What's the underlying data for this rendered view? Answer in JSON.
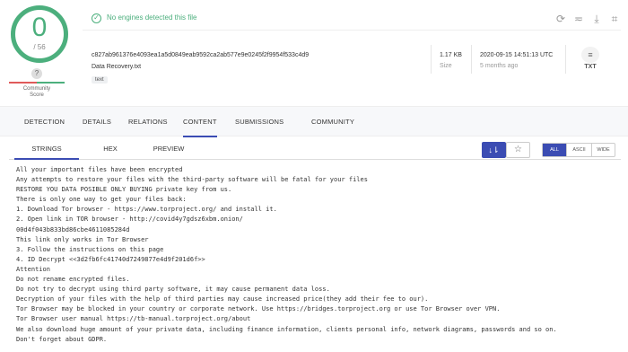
{
  "score": {
    "detections": "0",
    "total": "/ 56"
  },
  "community": {
    "question": "?",
    "bad_mark": "×",
    "good_mark": "✓",
    "label_line1": "Community",
    "label_line2": "Score"
  },
  "banner": {
    "status_text": "No engines detected this file"
  },
  "toolbar_icons": [
    "refresh-icon",
    "similar-icon",
    "download-icon",
    "graph-icon"
  ],
  "file": {
    "hash": "c827ab961376e4093ea1a5d0849eab9592ca2ab577e9e0245f2f9954f533c4d9",
    "name": "Data Recovery.txt",
    "tag": "text",
    "size_value": "1.17 KB",
    "size_label": "Size",
    "date_value": "2020-09-15 14:51:13 UTC",
    "date_label": "5 months ago",
    "type_label": "TXT"
  },
  "main_tabs": [
    {
      "label": "DETECTION",
      "active": false
    },
    {
      "label": "DETAILS",
      "active": false
    },
    {
      "label": "RELATIONS",
      "active": false
    },
    {
      "label": "CONTENT",
      "active": true
    },
    {
      "label": "SUBMISSIONS",
      "active": false
    },
    {
      "label": "COMMUNITY",
      "active": false
    }
  ],
  "sub_tabs": [
    {
      "label": "STRINGS",
      "active": true
    },
    {
      "label": "HEX",
      "active": false
    },
    {
      "label": "PREVIEW",
      "active": false
    }
  ],
  "filter": {
    "all": "ALL",
    "ascii": "ASCII",
    "wide": "WIDE"
  },
  "colors": {
    "accent": "#3b4cb3",
    "clean": "#4caf7d",
    "malicious": "#e05a5a"
  },
  "strings": [
    "All your important files have been encrypted",
    "Any attempts to restore your files with the third-party software will be fatal for your files",
    "RESTORE YOU DATA POSIBLE ONLY BUYING private key from us.",
    "There is only one way to get your files back:",
    "1. Download Tor browser - https://www.torproject.org/ and install it.",
    "2. Open link in TOR browser - http://covid4y7gdsz6xbm.onion/",
    "00d4f043b833bd86cbe4611085284d",
    "This link only works in Tor Browser",
    "3. Follow the instructions on this page",
    "4. ID Decrypt <<3d2fb6fc41740d7249877e4d9f201d6f>>",
    "Attention",
    "Do not rename encrypted files.",
    "Do not try to decrypt using third party software, it may cause permanent data loss.",
    "Decryption of your files with the help of third parties may cause increased price(they add their fee to our).",
    "Tor Browser may be blocked in your country or corporate network. Use https://bridges.torproject.org or use Tor Browser over VPN.",
    "Tor Browser user manual https://tb-manual.torproject.org/about",
    "We also download huge amount of your private data, including finance information, clients personal info, network diagrams, passwords and so on.",
    "Don't forget about GDPR."
  ]
}
